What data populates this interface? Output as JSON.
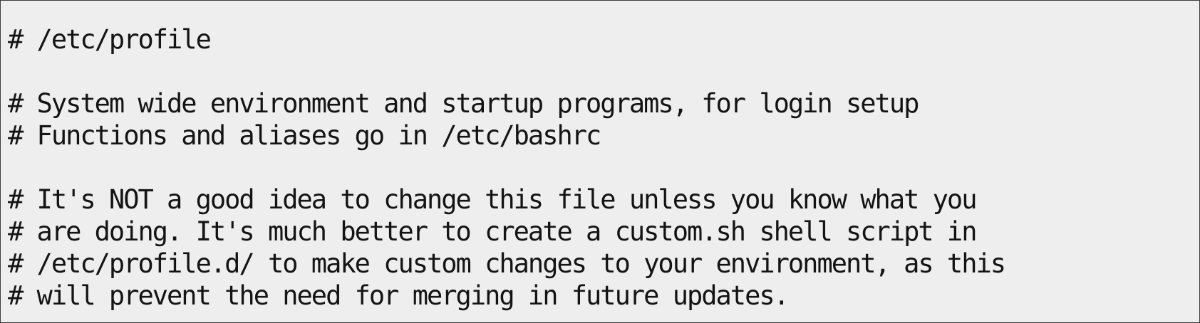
{
  "code_panel": {
    "lines": [
      "# /etc/profile",
      "",
      "# System wide environment and startup programs, for login setup",
      "# Functions and aliases go in /etc/bashrc",
      "",
      "# It's NOT a good idea to change this file unless you know what you",
      "# are doing. It's much better to create a custom.sh shell script in",
      "# /etc/profile.d/ to make custom changes to your environment, as this",
      "# will prevent the need for merging in future updates."
    ]
  }
}
